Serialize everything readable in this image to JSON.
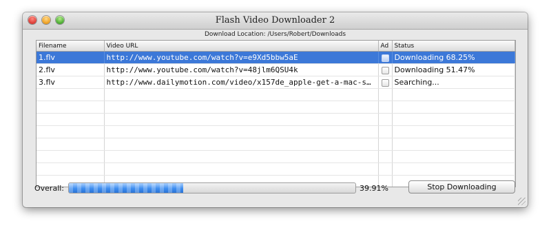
{
  "window": {
    "title": "Flash Video Downloader 2"
  },
  "download_location": "Download Location: /Users/Robert/Downloads",
  "table": {
    "columns": [
      "Filename",
      "Video URL",
      "Ad",
      "Status"
    ],
    "rows": [
      {
        "filename": "1.flv",
        "url": "http://www.youtube.com/watch?v=e9Xd5bbw5aE",
        "ad": false,
        "status": "Downloading 68.25%",
        "selected": true
      },
      {
        "filename": "2.flv",
        "url": "http://www.youtube.com/watch?v=48jlm6QSU4k",
        "ad": false,
        "status": "Downloading 51.47%",
        "selected": false
      },
      {
        "filename": "3.flv",
        "url": "http://www.dailymotion.com/video/x157de_apple-get-a-mac-s…",
        "ad": false,
        "status": "Searching...",
        "selected": false
      }
    ]
  },
  "overall": {
    "label": "Overall:",
    "progress_percent": 39.91,
    "percent_text": "39.91%"
  },
  "buttons": {
    "stop_label": "Stop Downloading"
  }
}
